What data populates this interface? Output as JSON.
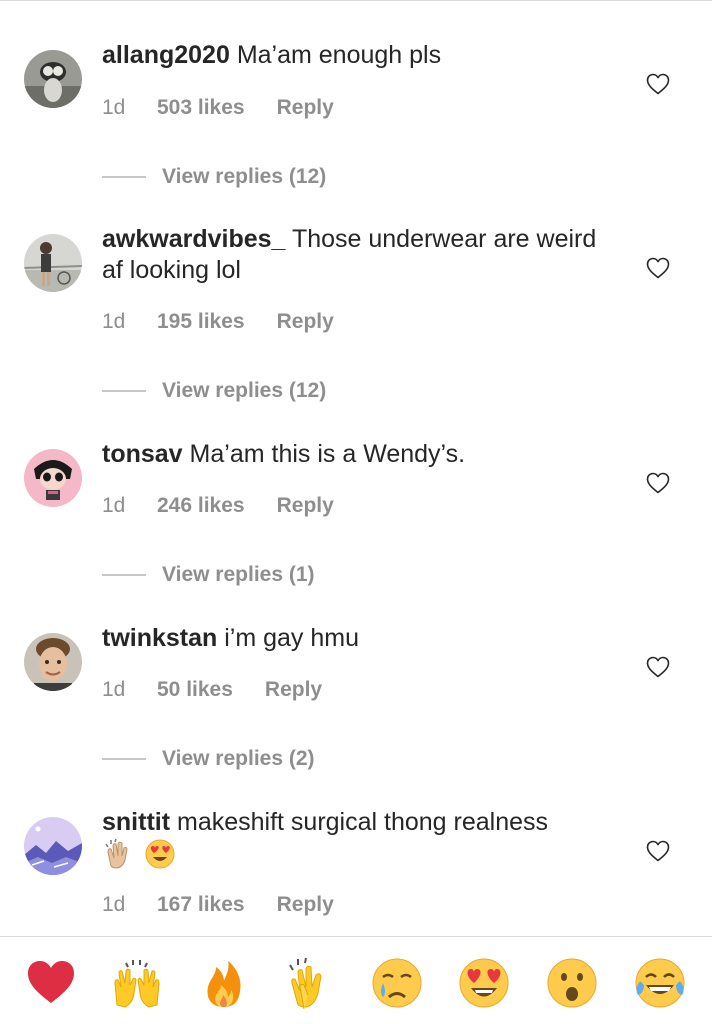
{
  "comments": [
    {
      "username": "allang2020",
      "text": "Ma’am enough pls",
      "time": "1d",
      "likes": "503 likes",
      "reply": "Reply",
      "view_replies": "View replies (12)"
    },
    {
      "username": "awkwardvibes_",
      "text": "Those underwear are weird af looking lol",
      "time": "1d",
      "likes": "195 likes",
      "reply": "Reply",
      "view_replies": "View replies (12)"
    },
    {
      "username": "tonsav",
      "text": "Ma’am this is a Wendy’s.",
      "time": "1d",
      "likes": "246 likes",
      "reply": "Reply",
      "view_replies": "View replies (1)"
    },
    {
      "username": "twinkstan",
      "text": "i’m gay hmu",
      "time": "1d",
      "likes": "50 likes",
      "reply": "Reply",
      "view_replies": "View replies (2)"
    },
    {
      "username": "snittit",
      "text": "makeshift surgical thong realness",
      "inline_emojis": [
        "clapping-hands-emoji",
        "heart-eyes-emoji"
      ],
      "time": "1d",
      "likes": "167 likes",
      "reply": "Reply"
    }
  ],
  "emoji_bar": [
    "red-heart-emoji",
    "raising-hands-emoji",
    "fire-emoji",
    "clapping-hands-emoji",
    "crying-face-emoji",
    "heart-eyes-emoji",
    "surprised-face-emoji",
    "tears-of-joy-emoji"
  ],
  "colors": {
    "text": "#262626",
    "secondary": "#8e8e8e",
    "divider": "#dbdbdb"
  }
}
